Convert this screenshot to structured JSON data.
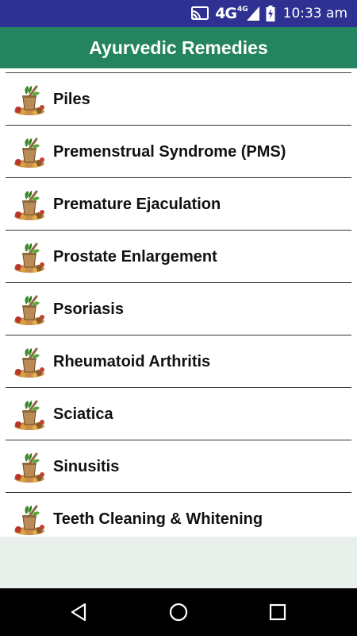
{
  "status_bar": {
    "network": "4G",
    "network_secondary": "4G",
    "time": "10:33 am",
    "icons": [
      "cast-icon",
      "signal-icon",
      "battery-charging-icon"
    ]
  },
  "app_bar": {
    "title": "Ayurvedic Remedies"
  },
  "remedies": [
    {
      "label": "Piles",
      "icon": "herbal-remedy-icon"
    },
    {
      "label": "Premenstrual Syndrome (PMS)",
      "icon": "herbal-remedy-icon"
    },
    {
      "label": "Premature Ejaculation",
      "icon": "herbal-remedy-icon"
    },
    {
      "label": "Prostate Enlargement",
      "icon": "herbal-remedy-icon"
    },
    {
      "label": "Psoriasis",
      "icon": "herbal-remedy-icon"
    },
    {
      "label": "Rheumatoid Arthritis",
      "icon": "herbal-remedy-icon"
    },
    {
      "label": "Sciatica",
      "icon": "herbal-remedy-icon"
    },
    {
      "label": "Sinusitis",
      "icon": "herbal-remedy-icon"
    },
    {
      "label": "Teeth Cleaning & Whitening",
      "icon": "herbal-remedy-icon"
    }
  ],
  "nav_bar": {
    "buttons": [
      "back-icon",
      "home-icon",
      "recents-icon"
    ]
  },
  "colors": {
    "status_bar": "#2e3192",
    "app_bar": "#23845f",
    "empty_area": "#e9f0ec",
    "nav_bar": "#000000"
  }
}
